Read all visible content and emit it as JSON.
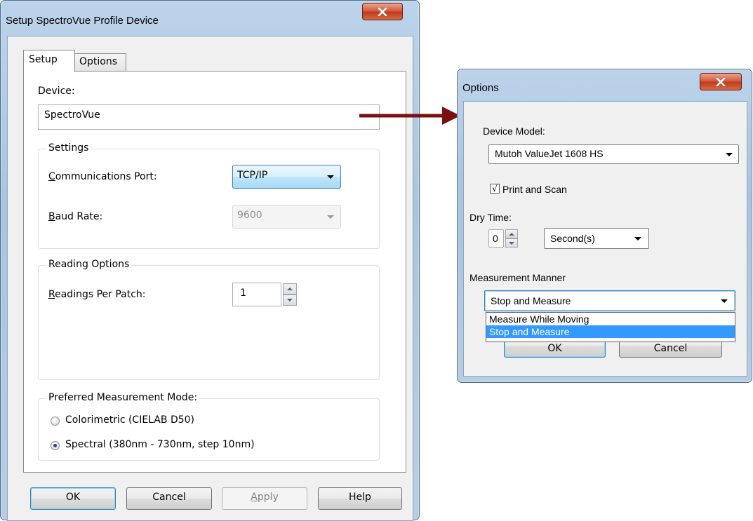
{
  "setup_dialog": {
    "title": "Setup SpectroVue Profile Device",
    "tabs": [
      {
        "label": "Setup"
      },
      {
        "label": "Options"
      }
    ],
    "device_label": "Device:",
    "device_value": "SpectroVue",
    "settings": {
      "title": "Settings",
      "port_label": "Communications Port:",
      "port_value": "TCP/IP",
      "baud_label": "Baud Rate:",
      "baud_value": "9600"
    },
    "reading_options": {
      "title": "Reading Options",
      "readings_label": "Readings Per Patch:",
      "readings_value": "1"
    },
    "measurement_mode": {
      "title": "Preferred Measurement Mode:",
      "options": [
        {
          "label": "Colorimetric (CIELAB D50)",
          "checked": false
        },
        {
          "label": "Spectral (380nm - 730nm, step 10nm)",
          "checked": true
        }
      ]
    },
    "buttons": {
      "ok": "OK",
      "cancel": "Cancel",
      "apply": "Apply",
      "help": "Help"
    }
  },
  "options_dialog": {
    "title": "Options",
    "device_model_label": "Device Model:",
    "device_model_value": "Mutoh ValueJet 1608 HS",
    "print_scan_label": "Print and Scan",
    "print_scan_checked": true,
    "dry_time_label": "Dry Time:",
    "dry_time_value": "0",
    "dry_time_unit": "Second(s)",
    "measurement_manner_label": "Measurement Manner",
    "measurement_manner_value": "Stop and Measure",
    "dropdown_options": [
      "Measure While Moving",
      "Stop and Measure"
    ],
    "selected_option_index": 1,
    "ok_label": "OK",
    "cancel_label": "Cancel"
  },
  "colors": {
    "arrow": "#7a1010",
    "selection": "#3399ff",
    "close_button": "#c23a1c"
  }
}
